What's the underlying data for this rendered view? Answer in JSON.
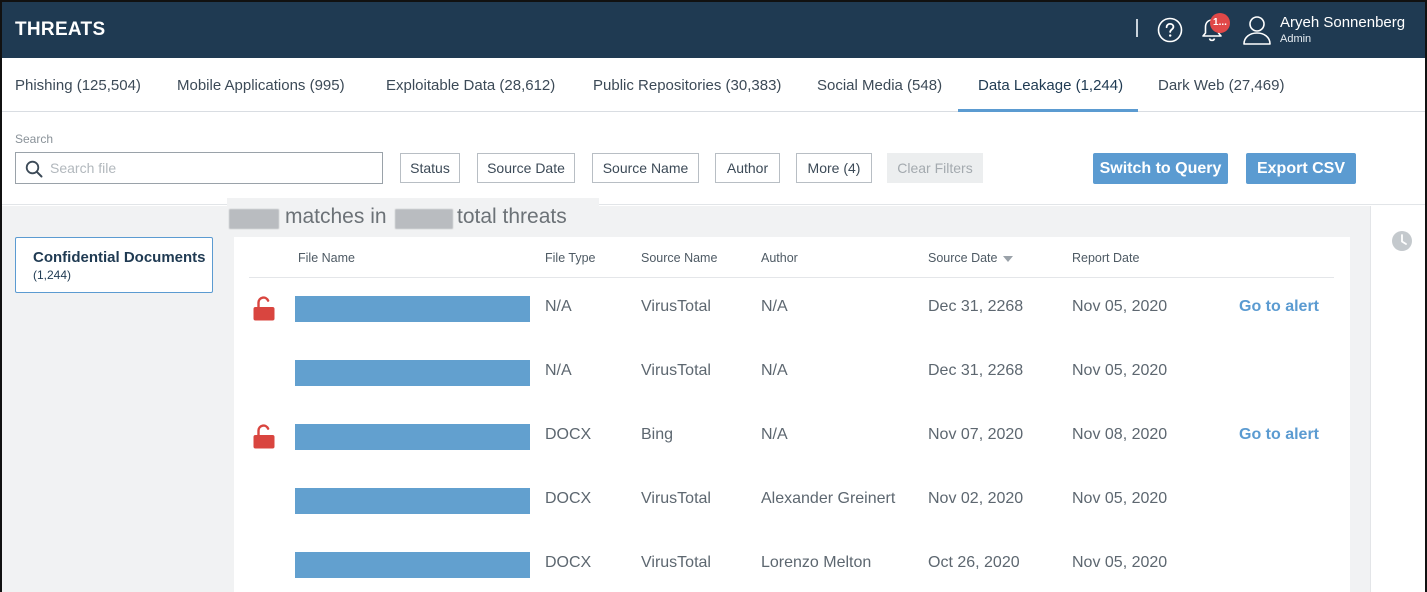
{
  "header": {
    "title": "THREATS",
    "divider": "|",
    "notification_badge": "1...",
    "user_name": "Aryeh Sonnenberg",
    "user_role": "Admin"
  },
  "tabs": [
    {
      "label": "Phishing (125,504)"
    },
    {
      "label": "Mobile Applications (995)"
    },
    {
      "label": "Exploitable Data (28,612)"
    },
    {
      "label": "Public Repositories (30,383)"
    },
    {
      "label": "Social Media (548)"
    },
    {
      "label": "Data Leakage (1,244)",
      "active": true
    },
    {
      "label": "Dark Web (27,469)"
    }
  ],
  "filters": {
    "search_label": "Search",
    "search_placeholder": "Search file",
    "search_value": "",
    "status": "Status",
    "source_date": "Source Date",
    "source_name": "Source Name",
    "author": "Author",
    "more": "More (4)",
    "clear": "Clear Filters",
    "switch_query": "Switch to Query",
    "export_csv": "Export CSV"
  },
  "matches": {
    "text_matches": "matches in",
    "text_total": "total threats"
  },
  "category": {
    "title": "Confidential Documents",
    "count": "(1,244)"
  },
  "table": {
    "columns": [
      "File Name",
      "File Type",
      "Source Name",
      "Author",
      "Source Date",
      "Report Date"
    ],
    "rows": [
      {
        "unlocked": true,
        "file_type": "N/A",
        "source_name": "VirusTotal",
        "author": "N/A",
        "source_date": "Dec 31, 2268",
        "report_date": "Nov 05, 2020",
        "action": "Go to alert"
      },
      {
        "unlocked": false,
        "file_type": "N/A",
        "source_name": "VirusTotal",
        "author": "N/A",
        "source_date": "Dec 31, 2268",
        "report_date": "Nov 05, 2020",
        "action": ""
      },
      {
        "unlocked": true,
        "file_type": "DOCX",
        "source_name": "Bing",
        "author": "N/A",
        "source_date": "Nov 07, 2020",
        "report_date": "Nov 08, 2020",
        "action": "Go to alert"
      },
      {
        "unlocked": false,
        "file_type": "DOCX",
        "source_name": "VirusTotal",
        "author": "Alexander Greinert",
        "source_date": "Nov 02, 2020",
        "report_date": "Nov 05, 2020",
        "action": ""
      },
      {
        "unlocked": false,
        "file_type": "DOCX",
        "source_name": "VirusTotal",
        "author": "Lorenzo Melton",
        "source_date": "Oct 26, 2020",
        "report_date": "Nov 05, 2020",
        "action": ""
      }
    ]
  },
  "colors": {
    "header_bg": "#1f3a52",
    "accent": "#5b9bd1",
    "lock_red": "#d9453f",
    "badge_red": "#e04848"
  },
  "icons": [
    "help-icon",
    "bell-icon",
    "user-icon",
    "search-icon",
    "clock-icon",
    "unlocked-lock-icon",
    "sort-desc-icon"
  ]
}
